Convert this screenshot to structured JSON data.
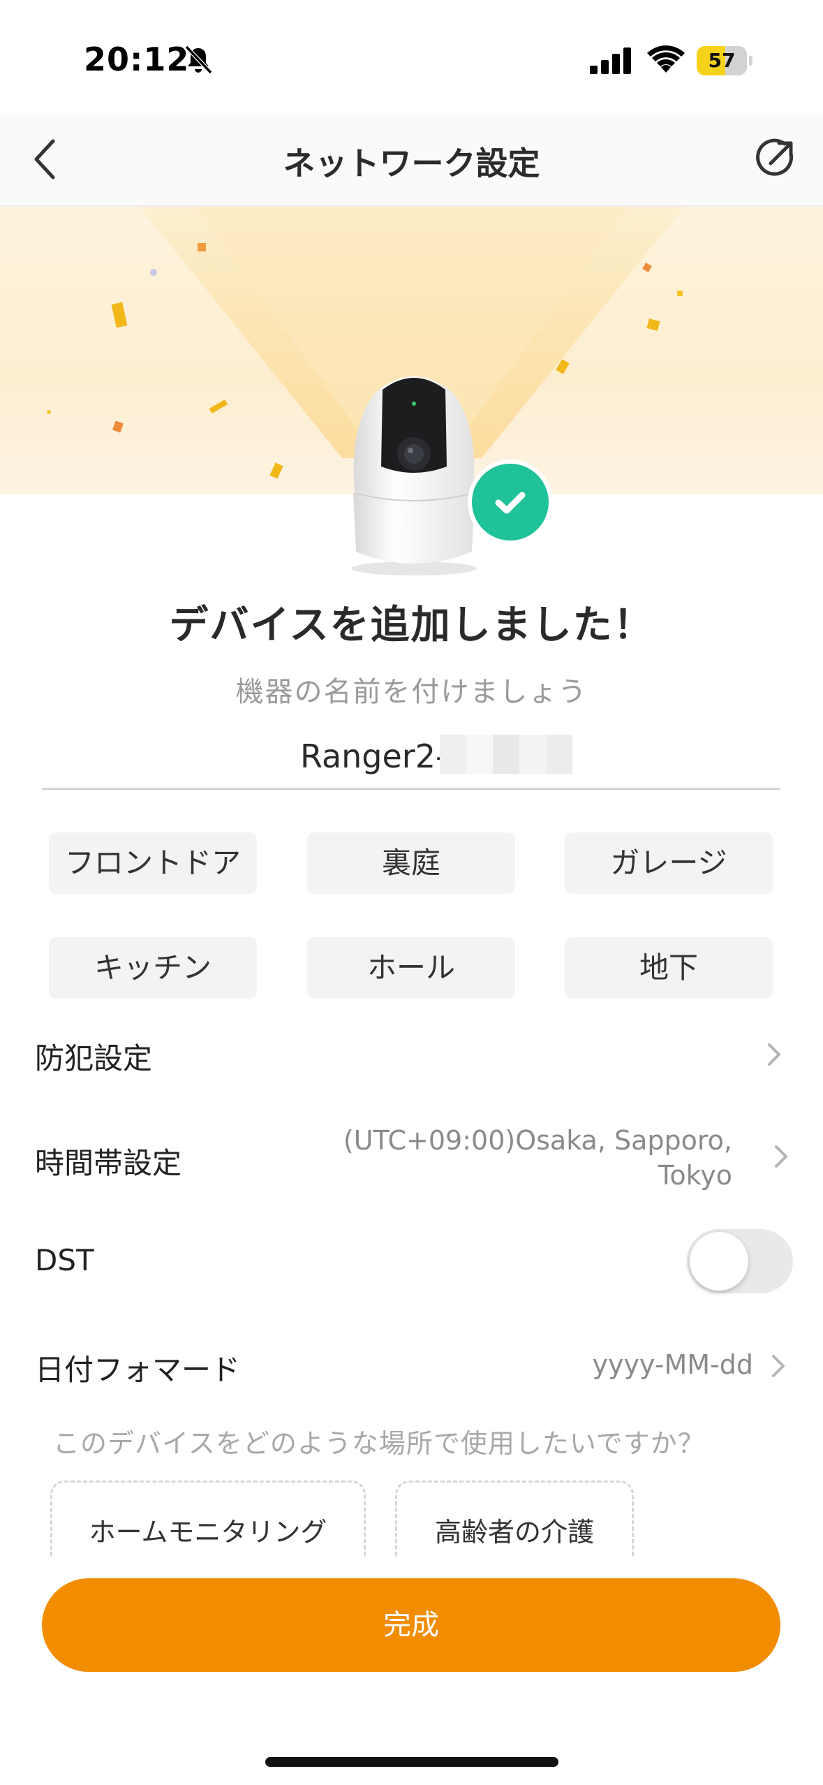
{
  "status_bar": {
    "time": "20:12",
    "battery_level": 57,
    "battery_label": "57"
  },
  "header": {
    "title": "ネットワーク設定"
  },
  "hero": {
    "title": "デバイスを追加しました！",
    "subtitle": "機器の名前を付けましょう"
  },
  "device_name": {
    "value": "Ranger2-"
  },
  "location_chips": [
    "フロントドア",
    "裏庭",
    "ガレージ",
    "キッチン",
    "ホール",
    "地下"
  ],
  "settings": {
    "security": {
      "label": "防犯設定"
    },
    "timezone": {
      "label": "時間帯設定",
      "value_line1": "(UTC+09:00)Osaka, Sapporo,",
      "value_line2": "Tokyo"
    },
    "dst": {
      "label": "DST",
      "enabled": false
    },
    "date_format": {
      "label": "日付フォマード",
      "value": "yyyy-MM-dd"
    }
  },
  "purpose": {
    "question": "このデバイスをどのような場所で使用したいですか？",
    "options": [
      "ホームモニタリング",
      "高齢者の介護"
    ]
  },
  "done_button": {
    "label": "完成"
  },
  "colors": {
    "accent": "#f28c00",
    "success": "#20c399",
    "battery": "#f7d21b"
  }
}
